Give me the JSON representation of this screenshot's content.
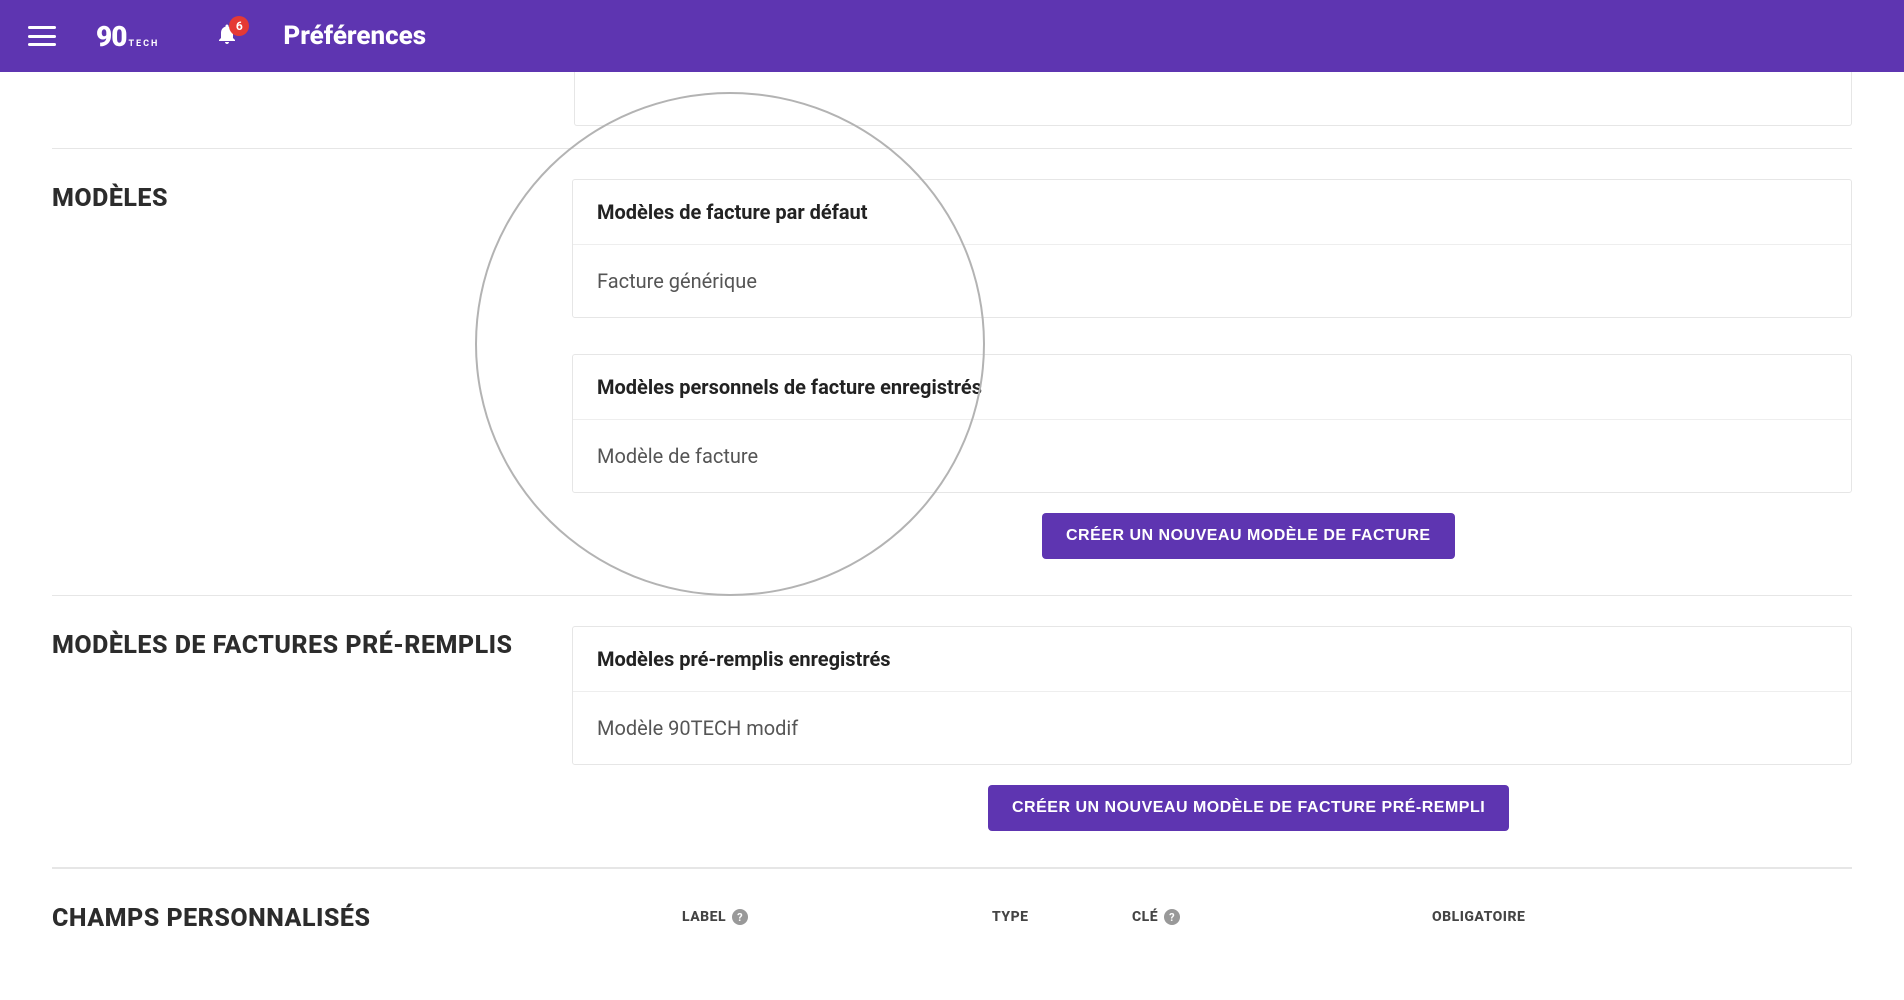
{
  "header": {
    "title": "Préférences",
    "logo_mark": "90",
    "logo_sub": "TECH",
    "notification_count": "6"
  },
  "sections": {
    "modeles": {
      "label": "MODÈLES",
      "default_card_title": "Modèles de facture par défaut",
      "default_card_value": "Facture générique",
      "personal_card_title": "Modèles personnels de facture enregistrés",
      "personal_card_value": "Modèle de facture",
      "button_label": "CRÉER UN NOUVEAU MODÈLE DE FACTURE"
    },
    "preremplis": {
      "label": "MODÈLES DE FACTURES PRÉ-REMPLIS",
      "card_title": "Modèles pré-remplis enregistrés",
      "card_value": "Modèle 90TECH modif",
      "button_label": "CRÉER UN NOUVEAU MODÈLE DE FACTURE PRÉ-REMPLI"
    },
    "champs": {
      "label": "CHAMPS PERSONNALISÉS",
      "columns": {
        "label": "LABEL",
        "type": "TYPE",
        "key": "CLÉ",
        "oblig": "OBLIGATOIRE"
      }
    }
  }
}
